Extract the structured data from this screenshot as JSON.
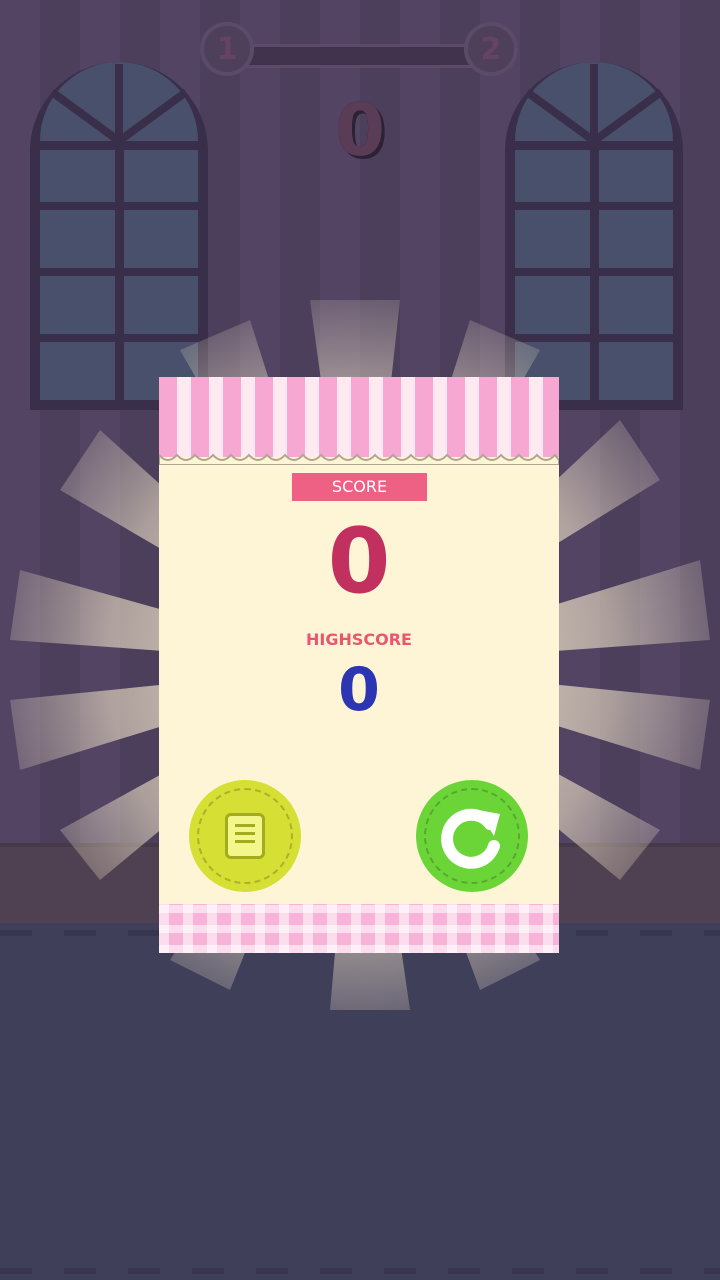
{
  "header": {
    "level_current": "1",
    "level_next": "2",
    "level_progress": 0,
    "current_score": "0"
  },
  "popup": {
    "score_label": "SCORE",
    "score_value": "0",
    "highscore_label": "HIGHSCORE",
    "highscore_value": "0"
  },
  "buttons": {
    "menu_icon": "menu-list-icon",
    "replay_icon": "replay-arrow-icon"
  },
  "colors": {
    "score_badge": "#ef6184",
    "score_value": "#c2305f",
    "highscore_value": "#2c35b2",
    "menu_button": "#d6df33",
    "replay_button": "#6bd538",
    "awning_pink": "#f6a8d2"
  }
}
